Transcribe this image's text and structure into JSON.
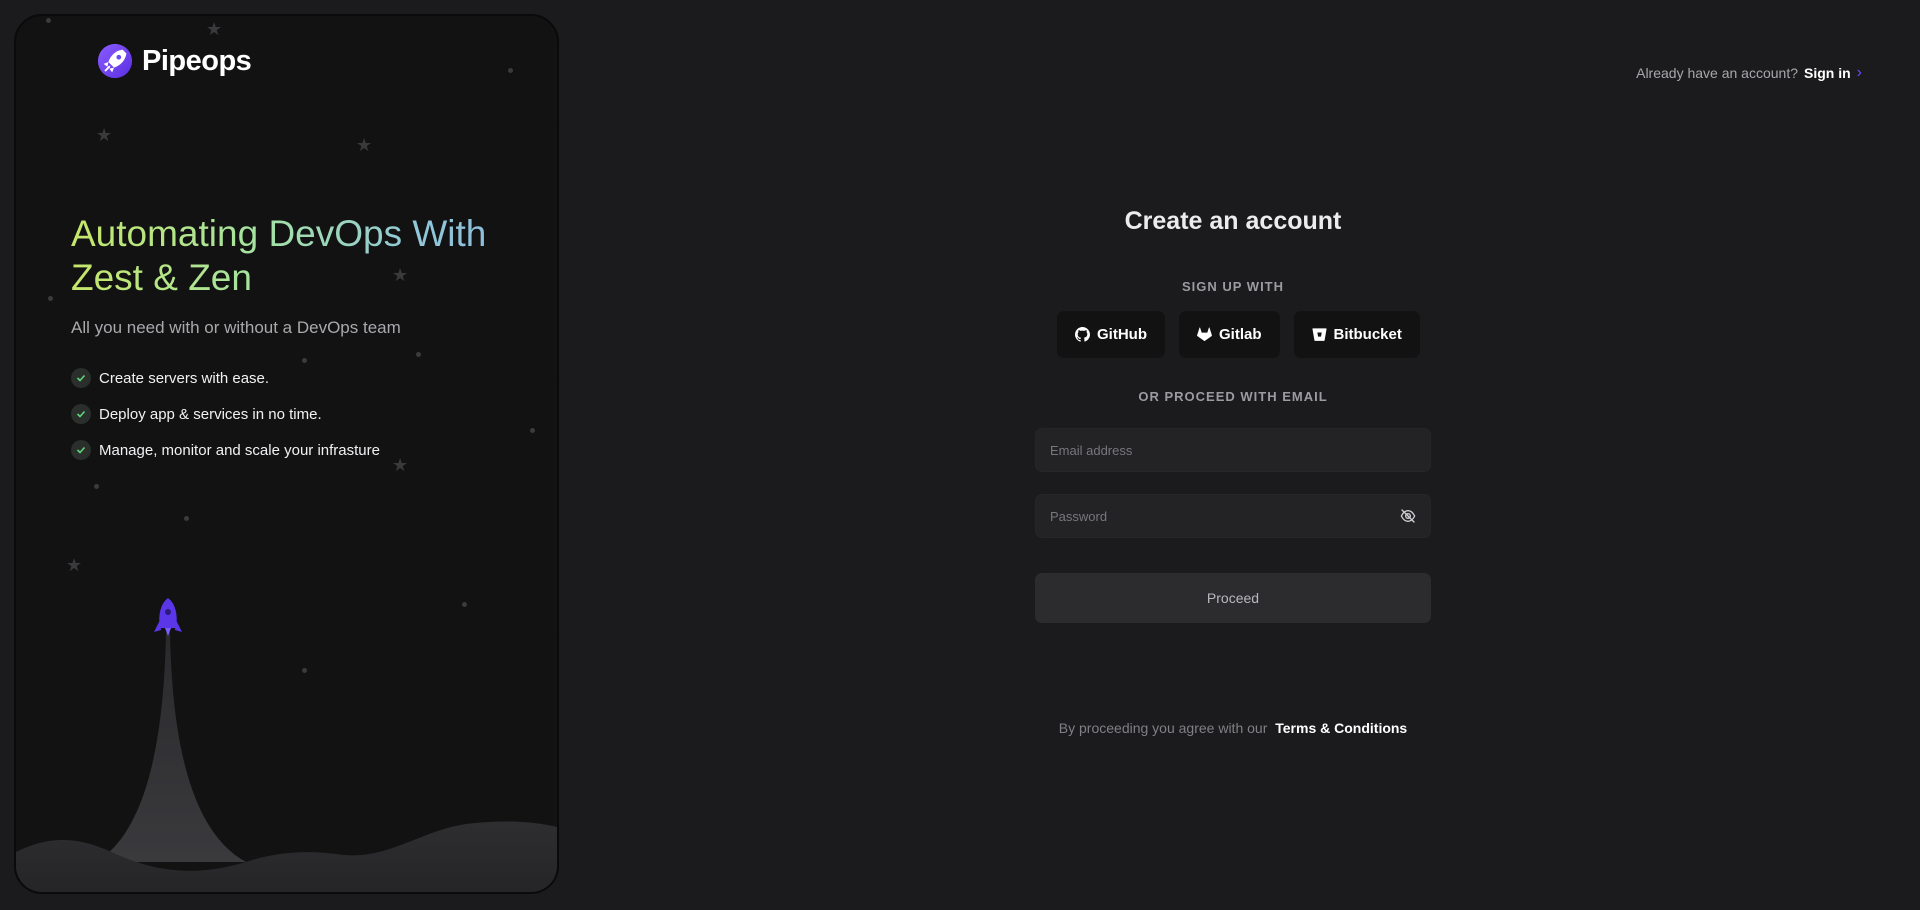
{
  "brand": {
    "name": "Pipeops",
    "accent": "#6b4cf5"
  },
  "hero": {
    "title": "Automating DevOps With Zest & Zen",
    "subtitle": "All you need with or without a DevOps team",
    "features": [
      "Create servers with ease.",
      "Deploy app & services in no time.",
      "Manage, monitor and scale your infrasture"
    ]
  },
  "header": {
    "question": "Already have an account?",
    "signin_label": "Sign in"
  },
  "form": {
    "title": "Create an account",
    "signup_with": "SIGN UP WITH",
    "providers": [
      {
        "label": "GitHub",
        "icon": "github-icon"
      },
      {
        "label": "Gitlab",
        "icon": "gitlab-icon"
      },
      {
        "label": "Bitbucket",
        "icon": "bitbucket-icon"
      }
    ],
    "or_email": "OR PROCEED WITH EMAIL",
    "email_placeholder": "Email address",
    "password_placeholder": "Password",
    "password_toggle_icon": "eye-off-icon",
    "proceed_label": "Proceed",
    "terms_prefix": "By proceeding you agree with our",
    "terms_link": "Terms & Conditions"
  }
}
